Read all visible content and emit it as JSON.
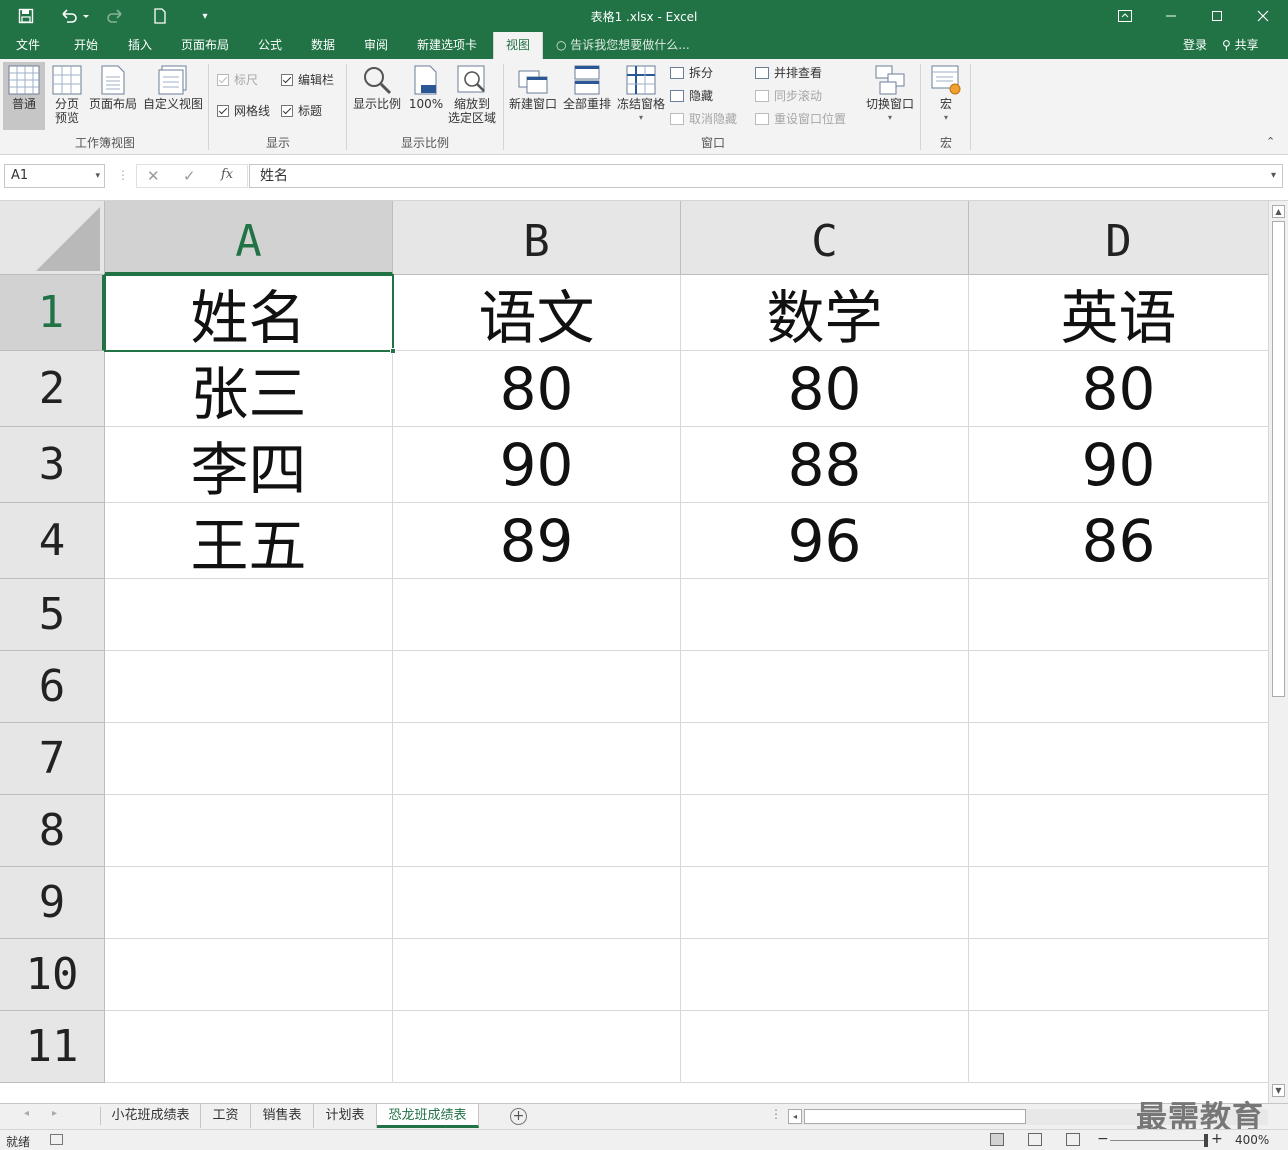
{
  "window": {
    "title": "表格1 .xlsx - Excel",
    "save_icon": "save-icon",
    "undo_icon": "undo-icon",
    "redo_icon": "redo-icon",
    "new_icon": "new-document-icon",
    "ribbon_display_icon": "ribbon-display-options-icon",
    "min_icon": "minimize-icon",
    "max_icon": "maximize-icon",
    "close_icon": "close-icon"
  },
  "menu": {
    "tabs": [
      "文件",
      "开始",
      "插入",
      "页面布局",
      "公式",
      "数据",
      "审阅",
      "新建选项卡",
      "视图"
    ],
    "active": "视图",
    "tell_me": "告诉我您想要做什么...",
    "login": "登录",
    "share": "共享"
  },
  "ribbon": {
    "workbook_views": {
      "label": "工作簿视图",
      "normal": "普通",
      "page_break_line1": "分页",
      "page_break_line2": "预览",
      "page_layout": "页面布局",
      "custom_views": "自定义视图"
    },
    "show": {
      "label": "显示",
      "ruler": "标尺",
      "formula_bar": "编辑栏",
      "gridlines": "网格线",
      "headings": "标题"
    },
    "zoom": {
      "label": "显示比例",
      "zoom": "显示比例",
      "hundred": "100%",
      "to_selection_line1": "缩放到",
      "to_selection_line2": "选定区域"
    },
    "window": {
      "label": "窗口",
      "new_window": "新建窗口",
      "arrange_all": "全部重排",
      "freeze_panes": "冻结窗格",
      "split": "拆分",
      "hide": "隐藏",
      "unhide": "取消隐藏",
      "side_by_side": "并排查看",
      "sync_scroll": "同步滚动",
      "reset_position": "重设窗口位置",
      "switch_windows": "切换窗口"
    },
    "macros": {
      "label": "宏",
      "macros": "宏"
    }
  },
  "formula_bar": {
    "name_box": "A1",
    "cancel": "✕",
    "enter": "✓",
    "fx": "fx",
    "content": "姓名"
  },
  "grid": {
    "columns": [
      "A",
      "B",
      "C",
      "D"
    ],
    "rows": [
      "1",
      "2",
      "3",
      "4",
      "5",
      "6",
      "7",
      "8",
      "9",
      "10",
      "11"
    ],
    "cells": [
      [
        "姓名",
        "语文",
        "数学",
        "英语"
      ],
      [
        "张三",
        "80",
        "80",
        "80"
      ],
      [
        "李四",
        "90",
        "88",
        "90"
      ],
      [
        "王五",
        "89",
        "96",
        "86"
      ]
    ],
    "selected": "A1"
  },
  "sheets": {
    "tabs": [
      "小花班成绩表",
      "工资",
      "销售表",
      "计划表",
      "恐龙班成绩表"
    ],
    "active": "恐龙班成绩表",
    "add": "+"
  },
  "status": {
    "ready": "就绪",
    "zoom": "400%",
    "zoom_minus": "−",
    "zoom_plus": "+"
  },
  "watermark": "最需教育",
  "colors": {
    "excel_green": "#217346"
  }
}
